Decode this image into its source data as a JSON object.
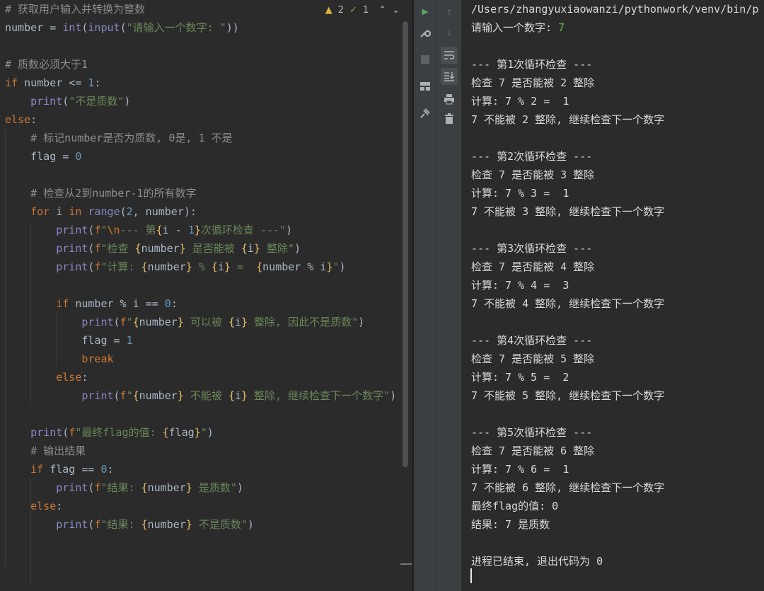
{
  "editor": {
    "inspections": {
      "warnings": "2",
      "weak_warnings": "1"
    },
    "code_lines": [
      [
        [
          "cm",
          "# 获取用户输入并转换为整数"
        ]
      ],
      [
        [
          "",
          "number = "
        ],
        [
          "bi",
          "int"
        ],
        [
          "",
          "("
        ],
        [
          "bi",
          "input"
        ],
        [
          "",
          "("
        ],
        [
          "st",
          "\"请输入一个数字: \""
        ],
        [
          "",
          "))"
        ]
      ],
      [],
      [
        [
          "cm",
          "# 质数必须大于1"
        ]
      ],
      [
        [
          "kw",
          "if "
        ],
        [
          "",
          "number <= "
        ],
        [
          "nm",
          "1"
        ],
        [
          "",
          ":"
        ]
      ],
      [
        [
          "",
          "    "
        ],
        [
          "bi",
          "print"
        ],
        [
          "",
          "("
        ],
        [
          "st",
          "\"不是质数\""
        ],
        [
          "",
          ")"
        ]
      ],
      [
        [
          "kw",
          "else"
        ],
        [
          "",
          ":"
        ]
      ],
      [
        [
          "",
          "    "
        ],
        [
          "cm",
          "# 标记number是否为质数, 0是, 1 不是"
        ]
      ],
      [
        [
          "",
          "    flag = "
        ],
        [
          "nm",
          "0"
        ]
      ],
      [],
      [
        [
          "",
          "    "
        ],
        [
          "cm",
          "# 检查从2到number-1的所有数字"
        ]
      ],
      [
        [
          "",
          "    "
        ],
        [
          "kw",
          "for "
        ],
        [
          "",
          "i "
        ],
        [
          "kw",
          "in "
        ],
        [
          "bi",
          "range"
        ],
        [
          "",
          "("
        ],
        [
          "nm",
          "2"
        ],
        [
          "",
          ", number):"
        ]
      ],
      [
        [
          "",
          "        "
        ],
        [
          "bi",
          "print"
        ],
        [
          "",
          "("
        ],
        [
          "dfl",
          "f"
        ],
        [
          "st",
          "\""
        ],
        [
          "dfl",
          "\\n"
        ],
        [
          "st",
          "--- 第"
        ],
        [
          "fb",
          "{"
        ],
        [
          "",
          "i - "
        ],
        [
          "nm",
          "1"
        ],
        [
          "fb",
          "}"
        ],
        [
          "st",
          "次循环检查 ---\""
        ],
        [
          "",
          ")"
        ]
      ],
      [
        [
          "",
          "        "
        ],
        [
          "bi",
          "print"
        ],
        [
          "",
          "("
        ],
        [
          "dfl",
          "f"
        ],
        [
          "st",
          "\"检查 "
        ],
        [
          "fb",
          "{"
        ],
        [
          "",
          "number"
        ],
        [
          "fb",
          "}"
        ],
        [
          "st",
          " 是否能被 "
        ],
        [
          "fb",
          "{"
        ],
        [
          "",
          "i"
        ],
        [
          "fb",
          "}"
        ],
        [
          "st",
          " 整除\""
        ],
        [
          "",
          ")"
        ]
      ],
      [
        [
          "",
          "        "
        ],
        [
          "bi",
          "print"
        ],
        [
          "",
          "("
        ],
        [
          "dfl",
          "f"
        ],
        [
          "st",
          "\"计算: "
        ],
        [
          "fb",
          "{"
        ],
        [
          "",
          "number"
        ],
        [
          "fb",
          "}"
        ],
        [
          "st",
          " % "
        ],
        [
          "fb",
          "{"
        ],
        [
          "",
          "i"
        ],
        [
          "fb",
          "}"
        ],
        [
          "st",
          " =  "
        ],
        [
          "fb",
          "{"
        ],
        [
          "",
          "number % i"
        ],
        [
          "fb",
          "}"
        ],
        [
          "st",
          "\""
        ],
        [
          "",
          ")"
        ]
      ],
      [],
      [
        [
          "",
          "        "
        ],
        [
          "kw",
          "if "
        ],
        [
          "",
          "number % i == "
        ],
        [
          "nm",
          "0"
        ],
        [
          "",
          ":"
        ]
      ],
      [
        [
          "",
          "            "
        ],
        [
          "bi",
          "print"
        ],
        [
          "",
          "("
        ],
        [
          "dfl",
          "f"
        ],
        [
          "st",
          "\""
        ],
        [
          "fb",
          "{"
        ],
        [
          "",
          "number"
        ],
        [
          "fb",
          "}"
        ],
        [
          "st",
          " 可以被 "
        ],
        [
          "fb",
          "{"
        ],
        [
          "",
          "i"
        ],
        [
          "fb",
          "}"
        ],
        [
          "st",
          " 整除, 因此不是质数\""
        ],
        [
          "",
          ")"
        ]
      ],
      [
        [
          "",
          "            flag = "
        ],
        [
          "nm",
          "1"
        ]
      ],
      [
        [
          "",
          "            "
        ],
        [
          "kw",
          "break"
        ]
      ],
      [
        [
          "",
          "        "
        ],
        [
          "kw",
          "else"
        ],
        [
          "",
          ":"
        ]
      ],
      [
        [
          "",
          "            "
        ],
        [
          "bi",
          "print"
        ],
        [
          "",
          "("
        ],
        [
          "dfl",
          "f"
        ],
        [
          "st",
          "\""
        ],
        [
          "fb",
          "{"
        ],
        [
          "",
          "number"
        ],
        [
          "fb",
          "}"
        ],
        [
          "st",
          " 不能被 "
        ],
        [
          "fb",
          "{"
        ],
        [
          "",
          "i"
        ],
        [
          "fb",
          "}"
        ],
        [
          "st",
          " 整除, 继续检查下一个数字\""
        ],
        [
          "",
          ")"
        ]
      ],
      [],
      [
        [
          "",
          "    "
        ],
        [
          "bi",
          "print"
        ],
        [
          "",
          "("
        ],
        [
          "dfl",
          "f"
        ],
        [
          "st",
          "\"最终flag的值: "
        ],
        [
          "fb",
          "{"
        ],
        [
          "",
          "flag"
        ],
        [
          "fb",
          "}"
        ],
        [
          "st",
          "\""
        ],
        [
          "",
          ")"
        ]
      ],
      [
        [
          "",
          "    "
        ],
        [
          "cm",
          "# 输出结果"
        ]
      ],
      [
        [
          "",
          "    "
        ],
        [
          "kw",
          "if "
        ],
        [
          "",
          "flag == "
        ],
        [
          "nm",
          "0"
        ],
        [
          "",
          ":"
        ]
      ],
      [
        [
          "",
          "        "
        ],
        [
          "bi",
          "print"
        ],
        [
          "",
          "("
        ],
        [
          "dfl",
          "f"
        ],
        [
          "st",
          "\"结果: "
        ],
        [
          "fb",
          "{"
        ],
        [
          "",
          "number"
        ],
        [
          "fb",
          "}"
        ],
        [
          "st",
          " 是质数\""
        ],
        [
          "",
          ")"
        ]
      ],
      [
        [
          "",
          "    "
        ],
        [
          "kw",
          "else"
        ],
        [
          "",
          ":"
        ]
      ],
      [
        [
          "",
          "        "
        ],
        [
          "bi",
          "print"
        ],
        [
          "",
          "("
        ],
        [
          "dfl",
          "f"
        ],
        [
          "st",
          "\"结果: "
        ],
        [
          "fb",
          "{"
        ],
        [
          "",
          "number"
        ],
        [
          "fb",
          "}"
        ],
        [
          "st",
          " 不是质数\""
        ],
        [
          "",
          ")"
        ]
      ]
    ]
  },
  "run_toolbar": {
    "icons": [
      "run-icon",
      "wrench-icon",
      "stop-icon",
      "layout-icon",
      "pin-icon"
    ]
  },
  "console_toolbar": {
    "icons": [
      "arrow-up-icon",
      "arrow-down-icon",
      "soft-wrap-icon",
      "scroll-to-end-icon",
      "print-icon",
      "trash-icon"
    ]
  },
  "console": {
    "path_line": "/Users/zhangyuxiaowanzi/pythonwork/venv/bin/p",
    "prompt": "请输入一个数字: ",
    "input_value": "7",
    "output_lines": [
      "",
      "--- 第1次循环检查 ---",
      "检查 7 是否能被 2 整除",
      "计算: 7 % 2 =  1",
      "7 不能被 2 整除, 继续检查下一个数字",
      "",
      "--- 第2次循环检查 ---",
      "检查 7 是否能被 3 整除",
      "计算: 7 % 3 =  1",
      "7 不能被 3 整除, 继续检查下一个数字",
      "",
      "--- 第3次循环检查 ---",
      "检查 7 是否能被 4 整除",
      "计算: 7 % 4 =  3",
      "7 不能被 4 整除, 继续检查下一个数字",
      "",
      "--- 第4次循环检查 ---",
      "检查 7 是否能被 5 整除",
      "计算: 7 % 5 =  2",
      "7 不能被 5 整除, 继续检查下一个数字",
      "",
      "--- 第5次循环检查 ---",
      "检查 7 是否能被 6 整除",
      "计算: 7 % 6 =  1",
      "7 不能被 6 整除, 继续检查下一个数字",
      "最终flag的值: 0",
      "结果: 7 是质数",
      "",
      "进程已结束, 退出代码为 0"
    ]
  }
}
